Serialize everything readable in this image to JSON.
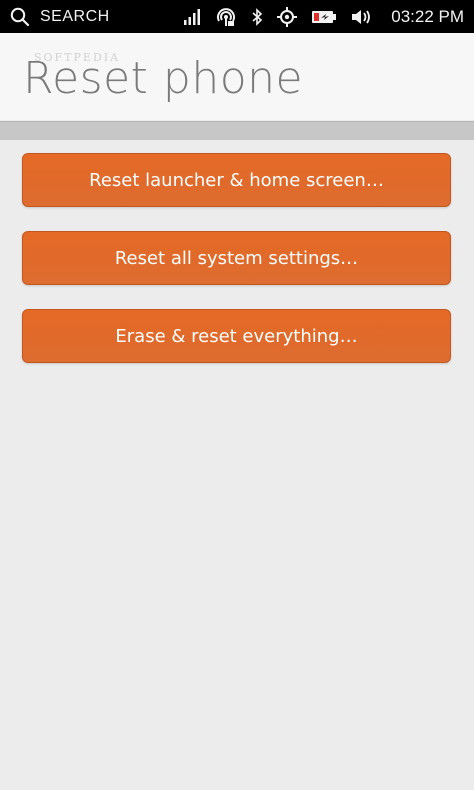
{
  "status_bar": {
    "search_label": "SEARCH",
    "time": "03:22 PM",
    "icons": [
      "search-icon",
      "signal-icon",
      "hotspot-icon",
      "bluetooth-icon",
      "location-icon",
      "battery-icon",
      "volume-icon"
    ]
  },
  "header": {
    "title": "Reset phone",
    "watermark": "SOFTPEDIA"
  },
  "actions": {
    "reset_launcher": "Reset launcher & home screen…",
    "reset_settings": "Reset all system settings…",
    "erase_everything": "Erase & reset everything…"
  },
  "colors": {
    "accent": "#e0652a",
    "background": "#ececec",
    "status_bar": "#000000"
  }
}
